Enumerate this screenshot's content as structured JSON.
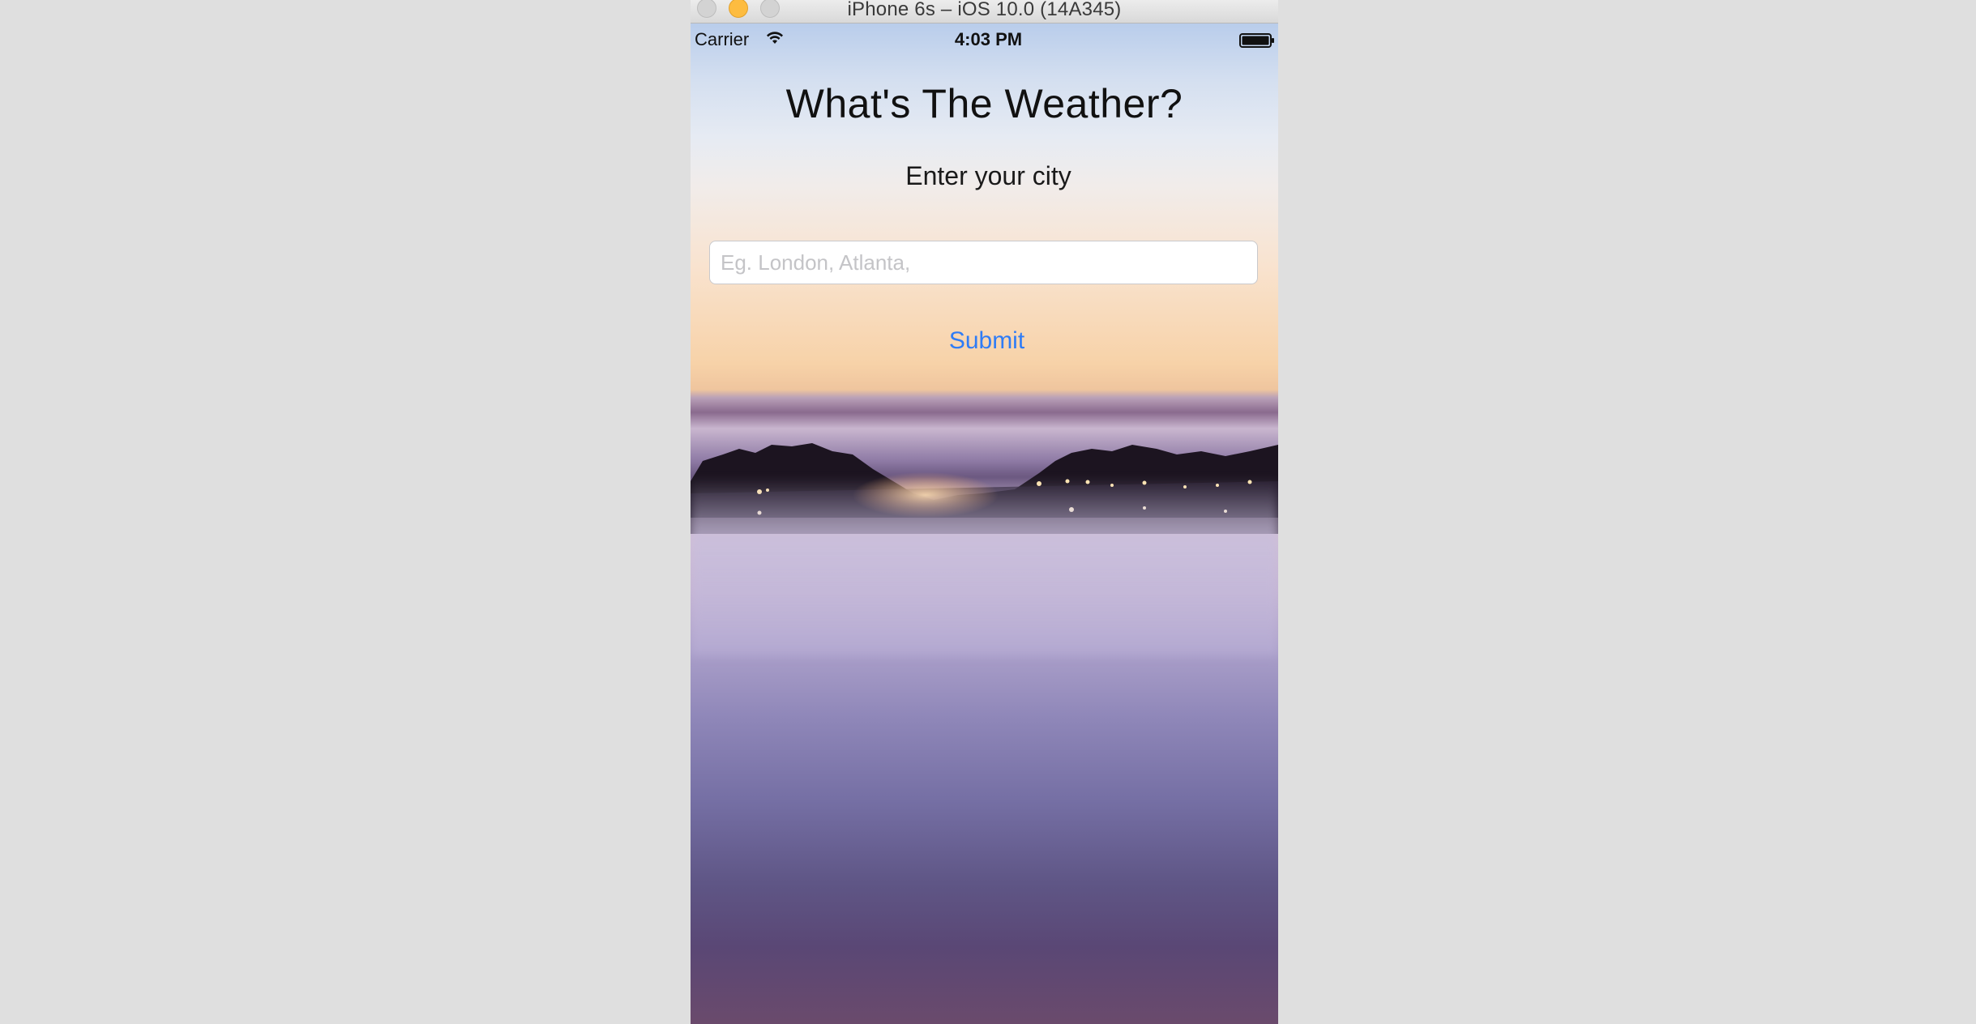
{
  "window": {
    "title": "iPhone 6s – iOS 10.0 (14A345)"
  },
  "status_bar": {
    "carrier": "Carrier",
    "time": "4:03 PM"
  },
  "app": {
    "title": "What's The Weather?",
    "subtitle": "Enter your city",
    "city_input": {
      "value": "",
      "placeholder": "Eg. London, Atlanta,"
    },
    "submit_label": "Submit"
  },
  "colors": {
    "accent": "#2f7cf6",
    "minimize_button": "#fdbc40"
  },
  "icons": {
    "wifi": "wifi-icon",
    "battery": "battery-icon",
    "close": "close-window-button",
    "minimize": "minimize-window-button",
    "zoom": "zoom-window-button"
  }
}
